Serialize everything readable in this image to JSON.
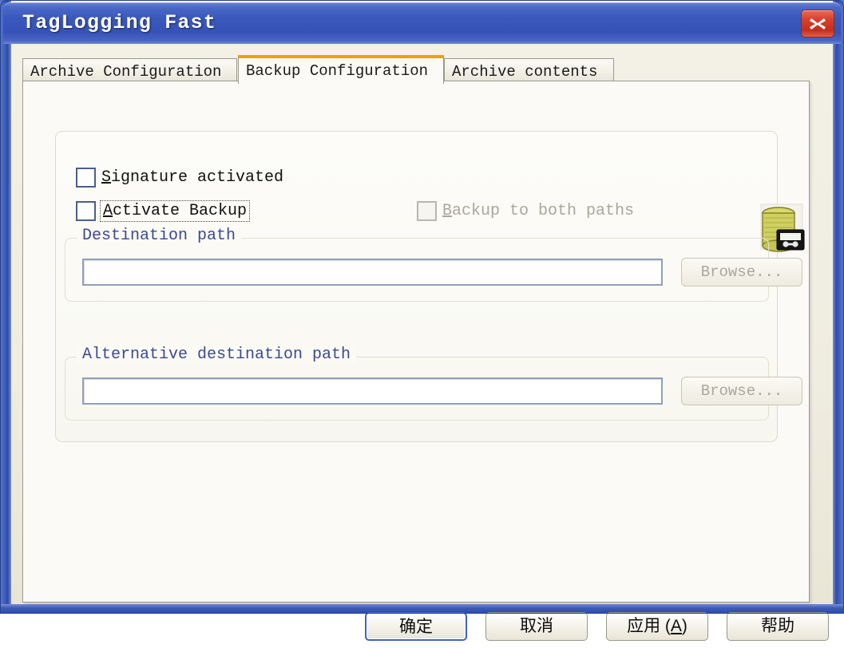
{
  "window": {
    "title": "TagLogging Fast",
    "close_icon": "close-x-icon",
    "titlebar_color": "#3a58bc",
    "close_color": "#d8412c"
  },
  "tabs": [
    {
      "label": "Archive Configuration",
      "active": false
    },
    {
      "label": "Backup Configuration",
      "active": true
    },
    {
      "label": "Archive contents",
      "active": false
    }
  ],
  "active_tab_accent": "#f29c10",
  "panel": {
    "icon": "backup-database-tape-icon",
    "checkboxes": [
      {
        "label_prefix": "",
        "accesskey": "S",
        "label_suffix": "ignature activated",
        "checked": false,
        "enabled": true,
        "focused": false
      },
      {
        "label_prefix": "",
        "accesskey": "A",
        "label_suffix": "ctivate Backup",
        "checked": false,
        "enabled": true,
        "focused": true
      },
      {
        "label_prefix": "",
        "accesskey": "B",
        "label_suffix": "ackup to both paths",
        "checked": false,
        "enabled": false,
        "focused": false
      }
    ],
    "groups": [
      {
        "legend": "Destination path",
        "input_value": "",
        "input_placeholder": "",
        "input_enabled": false,
        "browse_label": "Browse...",
        "browse_enabled": false
      },
      {
        "legend": "Alternative destination path",
        "input_value": "",
        "input_placeholder": "",
        "input_enabled": false,
        "browse_label": "Browse...",
        "browse_enabled": false
      }
    ],
    "legend_color": "#3b4a91"
  },
  "footer": {
    "buttons": [
      {
        "label": "确定",
        "accesskey": "",
        "default": true
      },
      {
        "label": "取消",
        "accesskey": "",
        "default": false
      },
      {
        "label_prefix": "应用 (",
        "accesskey": "A",
        "label_suffix": ")",
        "default": false
      },
      {
        "label": "帮助",
        "accesskey": "",
        "default": false
      }
    ]
  }
}
